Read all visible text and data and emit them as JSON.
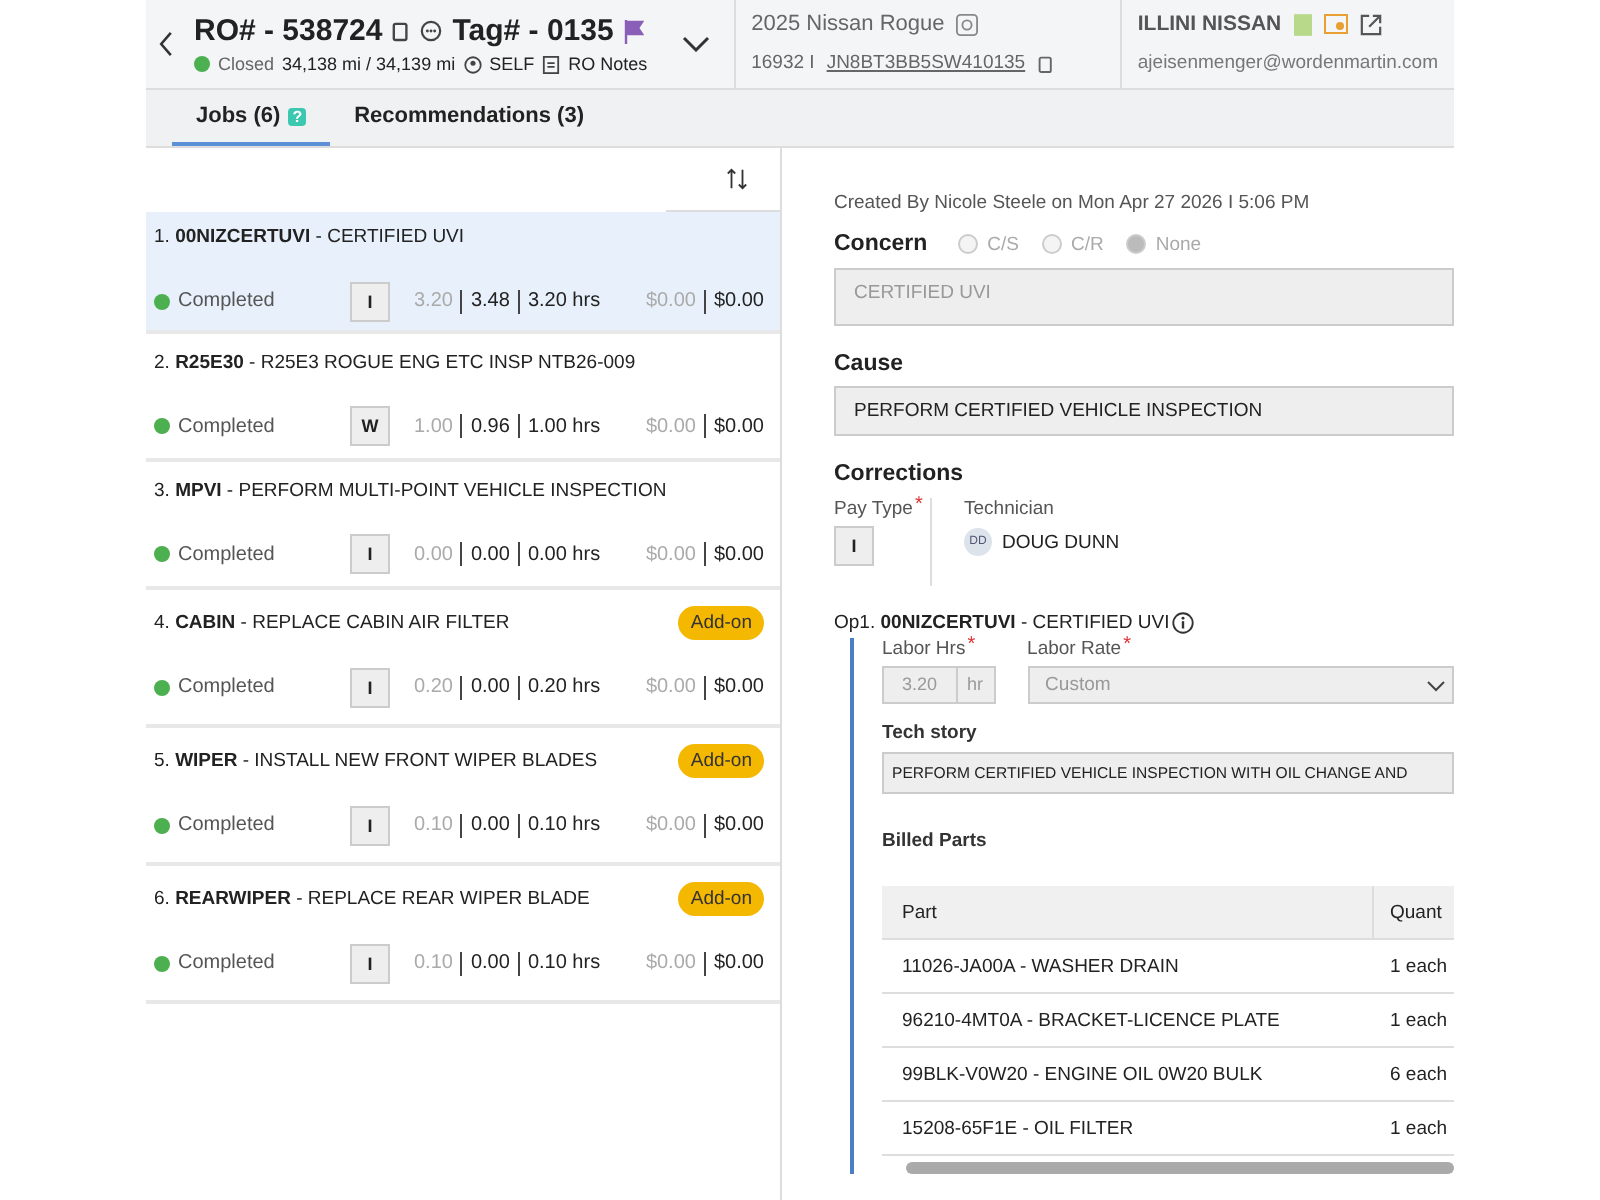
{
  "header": {
    "ro": "RO# - 538724",
    "tag": "Tag# - 0135",
    "status": "Closed",
    "mileage": "34,138 mi / 34,139 mi",
    "customer_type": "SELF",
    "notes": "RO Notes",
    "vehicle": "2025 Nissan Rogue",
    "stock": "16932 I",
    "vin": "JN8BT3BB5SW410135",
    "dealer": "ILLINI NISSAN",
    "email": "ajeisenmenger@wordenmartin.com"
  },
  "tabs": [
    {
      "label": "Jobs (6)",
      "selected": true,
      "badge": "?"
    },
    {
      "label": "Recommendations (3)",
      "selected": false
    }
  ],
  "jobs": [
    {
      "number": "1.",
      "code": "00NIZCERTUVI",
      "title": "- CERTIFIED UVI",
      "status": "Completed",
      "pay_type": "I",
      "sold": "3.20",
      "actual": "3.48",
      "billed": "3.20 hrs",
      "cost": "$0.00",
      "total": "$0.00",
      "selected": true
    },
    {
      "number": "2.",
      "code": "R25E30",
      "title": "- R25E3 ROGUE ENG ETC INSP NTB26-009",
      "status": "Completed",
      "pay_type": "W",
      "sold": "1.00",
      "actual": "0.96",
      "billed": "1.00 hrs",
      "cost": "$0.00",
      "total": "$0.00",
      "selected": false
    },
    {
      "number": "3.",
      "code": "MPVI",
      "title": "- PERFORM MULTI-POINT VEHICLE INSPECTION",
      "status": "Completed",
      "pay_type": "I",
      "sold": "0.00",
      "actual": "0.00",
      "billed": "0.00 hrs",
      "cost": "$0.00",
      "total": "$0.00",
      "selected": false
    },
    {
      "number": "4.",
      "code": "CABIN",
      "title": "- REPLACE CABIN AIR FILTER",
      "status": "Completed",
      "pay_type": "I",
      "sold": "0.20",
      "actual": "0.00",
      "billed": "0.20 hrs",
      "cost": "$0.00",
      "total": "$0.00",
      "addon": "Add-on",
      "selected": false
    },
    {
      "number": "5.",
      "code": "WIPER",
      "title": "- INSTALL NEW FRONT WIPER BLADES",
      "status": "Completed",
      "pay_type": "I",
      "sold": "0.10",
      "actual": "0.00",
      "billed": "0.10 hrs",
      "cost": "$0.00",
      "total": "$0.00",
      "addon": "Add-on",
      "selected": false
    },
    {
      "number": "6.",
      "code": "REARWIPER",
      "title": "- REPLACE REAR WIPER BLADE",
      "status": "Completed",
      "pay_type": "I",
      "sold": "0.10",
      "actual": "0.00",
      "billed": "0.10 hrs",
      "cost": "$0.00",
      "total": "$0.00",
      "addon": "Add-on",
      "selected": false
    }
  ],
  "detail": {
    "created": "Created By Nicole Steele on Mon Apr 27 2026 I 5:06 PM",
    "concern_label": "Concern",
    "concern_options": [
      {
        "label": "C/S",
        "selected": false
      },
      {
        "label": "C/R",
        "selected": false
      },
      {
        "label": "None",
        "selected": true
      }
    ],
    "concern": "CERTIFIED UVI",
    "cause_label": "Cause",
    "cause": "PERFORM CERTIFIED VEHICLE INSPECTION",
    "corrections_label": "Corrections",
    "pay_type_label": "Pay Type",
    "pay_type_mark": "*",
    "pay_type": "I",
    "technician_label": "Technician",
    "technician_initials": "DD",
    "technician": "DOUG DUNN",
    "op_prefix": "Op1.",
    "op_code": "00NIZCERTUVI",
    "op_title": "- CERTIFIED UVI",
    "labor_hrs_label": "Labor Hrs",
    "labor_hrs_mark": "*",
    "labor_hrs": "3.20",
    "labor_unit": "hr",
    "labor_rate_label": "Labor Rate",
    "labor_rate_mark": "*",
    "labor_rate": "Custom",
    "tech_story_label": "Tech story",
    "tech_story": "PERFORM CERTIFIED VEHICLE INSPECTION WITH OIL CHANGE AND",
    "billed_parts_label": "Billed Parts",
    "parts_columns": [
      "Part",
      "Quant"
    ],
    "parts": [
      {
        "part": "11026-JA00A - WASHER DRAIN",
        "qty": "1 each"
      },
      {
        "part": "96210-4MT0A - BRACKET-LICENCE PLATE",
        "qty": "1 each"
      },
      {
        "part": "99BLK-V0W20 - ENGINE OIL 0W20 BULK",
        "qty": "6 each"
      },
      {
        "part": "15208-65F1E - OIL FILTER",
        "qty": "1 each"
      }
    ]
  }
}
